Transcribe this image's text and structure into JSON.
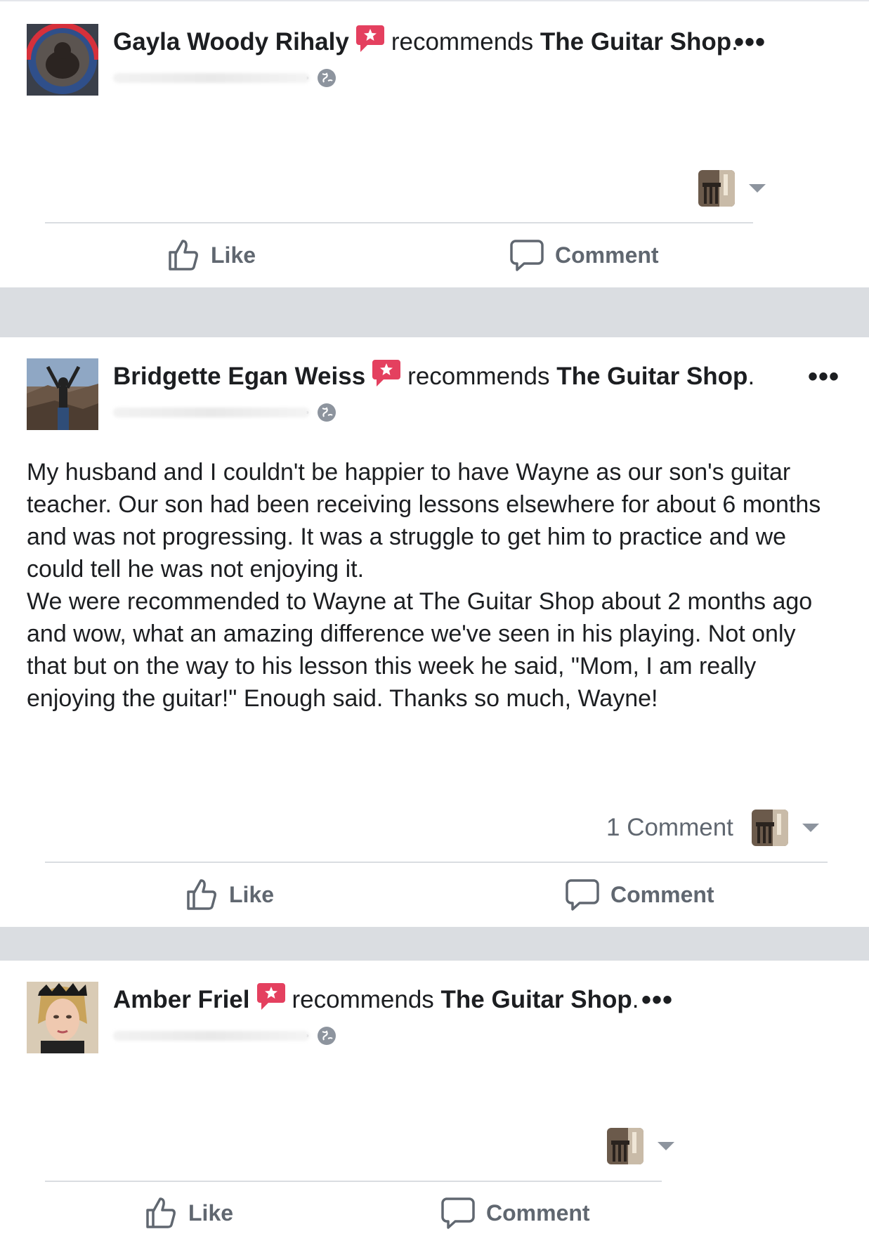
{
  "posts": [
    {
      "author": "Gayla Woody Rihaly",
      "verb": "recommends",
      "page": "The Guitar Shop",
      "punct": ".",
      "more": "•••",
      "text": [],
      "comment_count": "",
      "actions": {
        "like": "Like",
        "comment": "Comment"
      }
    },
    {
      "author": "Bridgette Egan Weiss",
      "verb": "recommends",
      "page": "The Guitar Shop",
      "punct": ".",
      "more": "•••",
      "text": [
        "My husband and I couldn't be happier to have Wayne as our son's guitar teacher. Our son had been receiving lessons elsewhere for about 6 months and was not progressing. It was a struggle to get him to practice and we could tell he was not enjoying it.",
        "We were recommended to Wayne at The Guitar Shop about 2 months ago and wow, what an amazing difference we've seen in his playing. Not only that but on the way to his lesson this week he said, \"Mom, I am really enjoying the guitar!\" Enough said. Thanks so much, Wayne!"
      ],
      "comment_count": "1 Comment",
      "actions": {
        "like": "Like",
        "comment": "Comment"
      }
    },
    {
      "author": "Amber Friel",
      "verb": "recommends",
      "page": "The Guitar Shop",
      "punct": ".",
      "more": "•••",
      "text": [],
      "comment_count": "",
      "actions": {
        "like": "Like",
        "comment": "Comment"
      }
    }
  ],
  "colors": {
    "recommend_badge": "#e4405f",
    "separator": "#dadde1",
    "action_text": "#606770"
  },
  "icons": [
    "recommend-badge-icon",
    "globe-icon",
    "more-options-icon",
    "like-icon",
    "comment-icon",
    "chevron-down-icon"
  ]
}
